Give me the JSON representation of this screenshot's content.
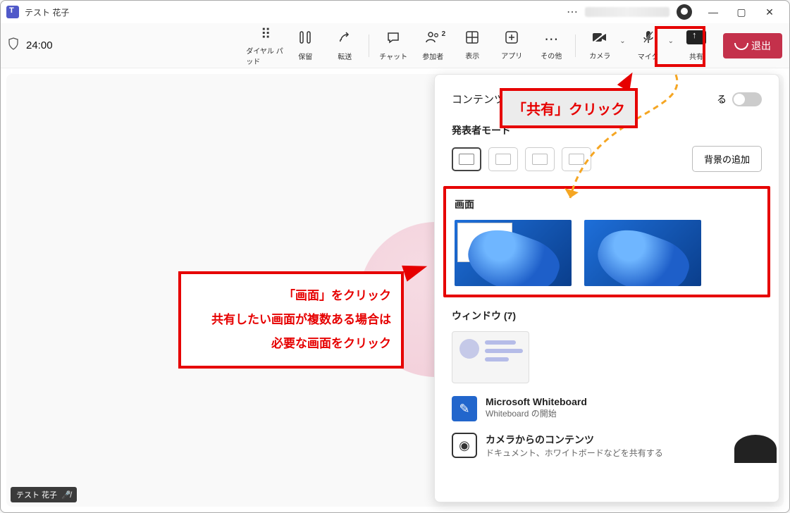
{
  "titlebar": {
    "title": "テスト 花子"
  },
  "toolbar": {
    "timer": "24:00",
    "dialpad": "ダイヤル パッド",
    "hold": "保留",
    "transfer": "転送",
    "chat": "チャット",
    "participants": "参加者",
    "participants_badge": "2",
    "view": "表示",
    "apps": "アプリ",
    "more": "その他",
    "camera": "カメラ",
    "mic": "マイク",
    "share": "共有",
    "leave": "退出"
  },
  "participant": {
    "name": "テスト 花子"
  },
  "share_panel": {
    "content_label_prefix": "コンテンツ",
    "sound_suffix": "る",
    "presenter_mode": "発表者モード",
    "add_bg": "背景の追加",
    "screen": "画面",
    "window": "ウィンドウ (7)",
    "whiteboard_title": "Microsoft Whiteboard",
    "whiteboard_sub": "Whiteboard の開始",
    "camera_content_title": "カメラからのコンテンツ",
    "camera_content_sub": "ドキュメント、ホワイトボードなどを共有する"
  },
  "callouts": {
    "share_click": "「共有」クリック",
    "screen_line1": "「画面」をクリック",
    "screen_line2": "共有したい画面が複数ある場合は",
    "screen_line3": "必要な画面をクリック"
  }
}
